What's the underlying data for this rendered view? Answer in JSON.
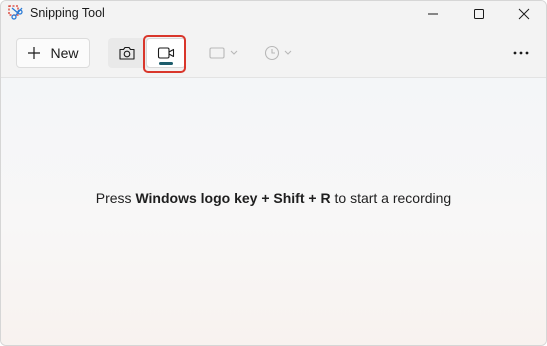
{
  "window": {
    "title": "Snipping Tool",
    "icons": {
      "app": "snipping-tool-icon",
      "minimize": "minimize-icon",
      "maximize": "maximize-icon",
      "close": "close-icon"
    }
  },
  "toolbar": {
    "new_label": "New",
    "new_icon": "plus-icon",
    "modes": [
      {
        "name": "screenshot",
        "icon": "camera-icon",
        "selected": false
      },
      {
        "name": "record",
        "icon": "video-camera-icon",
        "selected": true
      }
    ],
    "snip_shape_icon": "rectangle-icon",
    "delay_icon": "clock-icon",
    "more_icon": "ellipsis-icon"
  },
  "content": {
    "hint_prefix": "Press ",
    "hint_keys_1": "Windows logo key",
    "hint_plus_1": " + ",
    "hint_keys_2": "Shift",
    "hint_plus_2": " + ",
    "hint_keys_3": "R",
    "hint_suffix": " to start a recording"
  },
  "colors": {
    "accent": "#1d5c6b",
    "highlight": "#d9362b",
    "window_bg": "#f3f3f3"
  }
}
